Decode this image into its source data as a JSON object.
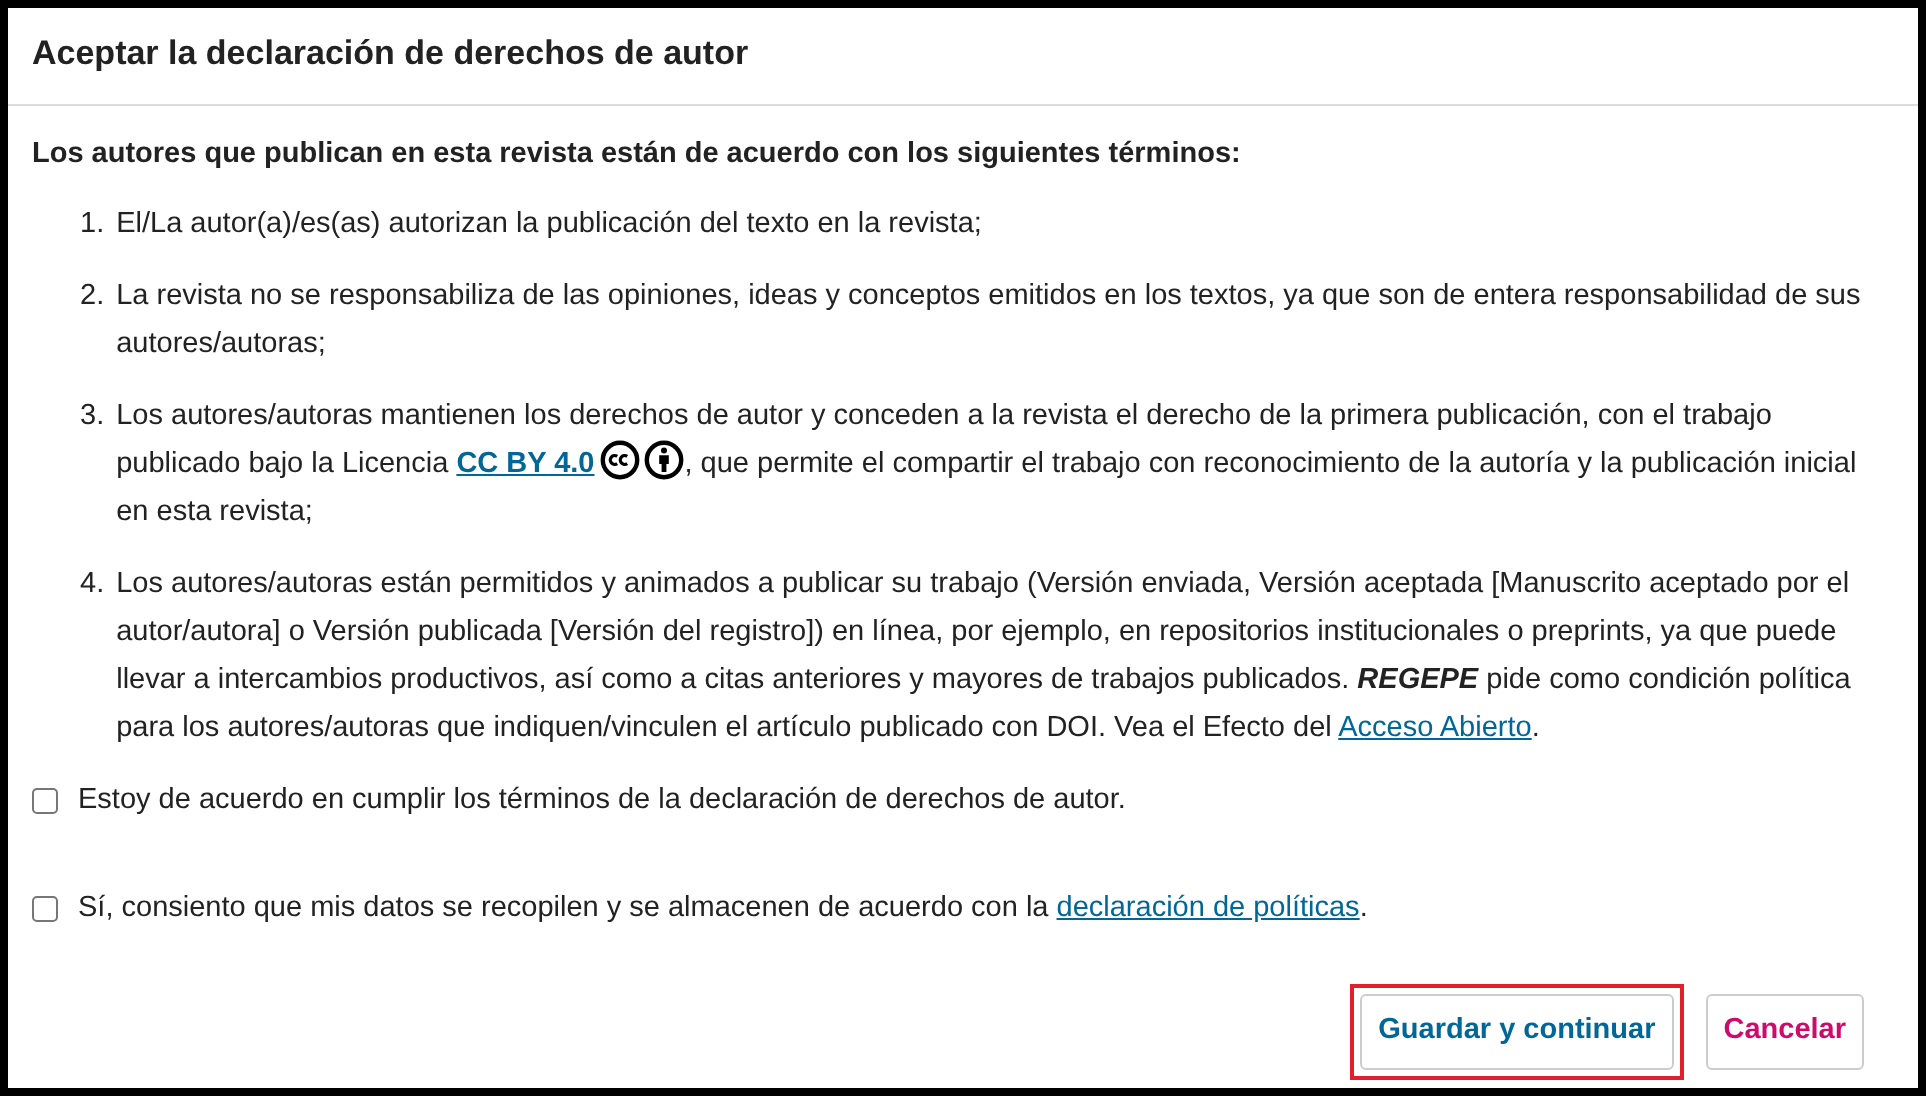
{
  "title": "Aceptar la declaración de derechos de autor",
  "intro": "Los autores que publican en esta revista están de acuerdo con los siguientes términos:",
  "terms": [
    {
      "number": "1.",
      "parts": [
        {
          "kind": "text",
          "text": "El/La autor(a)/es(as) autorizan la publicación del texto en la revista;"
        }
      ]
    },
    {
      "number": "2.",
      "parts": [
        {
          "kind": "text",
          "text": "La revista no se responsabiliza de las opiniones, ideas y conceptos emitidos en los textos, ya que son de entera responsabilidad de sus autores/autoras;"
        }
      ]
    },
    {
      "number": "3.",
      "parts": [
        {
          "kind": "text",
          "text": "Los autores/autoras mantienen los derechos de autor y conceden a la revista el derecho de la primera publicación, con el trabajo publicado bajo la Licencia "
        },
        {
          "kind": "link",
          "text": "CC BY 4.0"
        },
        {
          "kind": "license-icons"
        },
        {
          "kind": "text",
          "text": ", que permite el compartir el trabajo con reconocimiento de la autoría y la publicación inicial en esta revista;"
        }
      ]
    },
    {
      "number": "4.",
      "parts": [
        {
          "kind": "text",
          "text": "Los autores/autoras están permitidos y animados a publicar su trabajo (Versión enviada, Versión aceptada [Manuscrito aceptado por el autor/autora] o Versión publicada [Versión del registro]) en línea, por ejemplo, en repositorios institucionales o preprints, ya que puede llevar a intercambios productivos, así como a citas anteriores y mayores de trabajos publicados. "
        },
        {
          "kind": "emphasis",
          "text": "REGEPE"
        },
        {
          "kind": "text",
          "text": " pide como condición política para los autores/autoras que indiquen/vinculen el artículo publicado con DOI. Vea el Efecto del "
        },
        {
          "kind": "plainlink",
          "text": "Acceso Abierto"
        },
        {
          "kind": "text",
          "text": "."
        }
      ]
    }
  ],
  "checkboxes": [
    {
      "checked": false,
      "parts": [
        {
          "kind": "text",
          "text": "Estoy de acuerdo en cumplir los términos de la declaración de derechos de autor."
        }
      ]
    },
    {
      "checked": false,
      "parts": [
        {
          "kind": "text",
          "text": "Sí, consiento que mis datos se recopilen y se almacenen de acuerdo con la "
        },
        {
          "kind": "plainlink",
          "text": "declaración de políticas"
        },
        {
          "kind": "text",
          "text": "."
        }
      ]
    }
  ],
  "buttons": [
    {
      "kind": "primary",
      "label": "Guardar y continuar",
      "highlighted": true
    },
    {
      "kind": "cancel",
      "label": "Cancelar",
      "highlighted": false
    }
  ]
}
